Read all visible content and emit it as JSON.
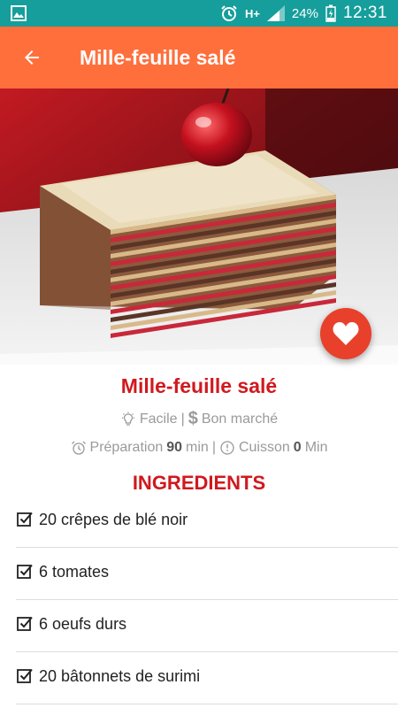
{
  "status_bar": {
    "network": "H+",
    "battery_percent": "24%",
    "time": "12:31",
    "icons": [
      "image-icon",
      "alarm-icon",
      "signal-icon",
      "battery-charging-icon"
    ]
  },
  "app_bar": {
    "title": "Mille-feuille salé",
    "back_icon": "arrow-back-icon"
  },
  "hero": {
    "image_subject": "mille-feuille",
    "favorite_icon": "heart-icon"
  },
  "recipe": {
    "title": "Mille-feuille salé",
    "difficulty": "Facile",
    "separator": "|",
    "cost": "Bon marché",
    "prep_label": "Préparation",
    "prep_value": "90",
    "prep_unit": "min",
    "cook_label": "Cuisson",
    "cook_value": "0",
    "cook_unit": "Min"
  },
  "ingredients": {
    "heading": "INGREDIENTS",
    "items": [
      "20 crêpes de blé noir",
      "6 tomates",
      "6 oeufs durs",
      "20 bâtonnets de surimi"
    ]
  },
  "colors": {
    "status_bar": "#159e9b",
    "app_bar": "#ff6f3c",
    "title_red": "#d0191e",
    "fav_button": "#e8402b"
  }
}
